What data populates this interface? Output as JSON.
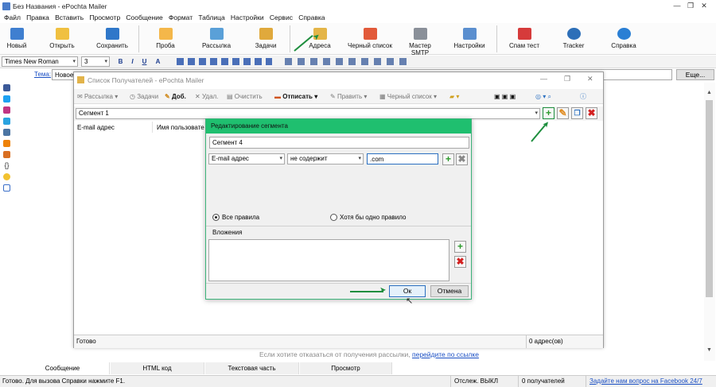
{
  "app": {
    "title": "Без Названия - ePochta Mailer"
  },
  "window_controls": {
    "minimize": "—",
    "maximize": "❐",
    "close": "✕"
  },
  "menu": [
    "Файл",
    "Правка",
    "Вставить",
    "Просмотр",
    "Сообщение",
    "Формат",
    "Таблица",
    "Настройки",
    "Сервис",
    "Справка"
  ],
  "toolbar": {
    "new": "Новый",
    "open": "Открыть",
    "save": "Сохранить",
    "test": "Проба",
    "send": "Рассылка",
    "tasks": "Задачи",
    "addresses": "Адреса",
    "blacklist": "Черный список",
    "smtp": "Мастер SMTP",
    "settings": "Настройки",
    "spamtest": "Спам тест",
    "tracker": "Tracker",
    "help": "Справка"
  },
  "format": {
    "font": "Times New Roman",
    "size": "3",
    "bold": "B",
    "italic": "I",
    "underline": "U",
    "color": "A"
  },
  "subject": {
    "label": "Тема:",
    "value": "Новое (",
    "more_button": "Еще..."
  },
  "recipients": {
    "title": "Список Получателей - ePochta Mailer",
    "toolbar": {
      "send": "Рассылка",
      "tasks": "Задачи",
      "add": "Доб.",
      "delete": "Удал.",
      "clear": "Очистить",
      "unsubscribe": "Отписать",
      "edit": "Править",
      "blacklist": "Черный список"
    },
    "segment": "Сегмент 1",
    "columns": [
      "E-mail адрес",
      "Имя пользовате"
    ],
    "status_left": "Готово",
    "status_right": "0 адрес(ов)"
  },
  "dialog": {
    "title": "Редактирование сегмента",
    "name_value": "Сегмент 4",
    "field_select": "E-mail адрес",
    "condition_select": "не содержит",
    "condition_value": ".com",
    "radio_all": "Все правила",
    "radio_any": "Хотя бы одно правило",
    "radio_all_checked": true,
    "attachments_label": "Вложения",
    "ok": "Ок",
    "cancel": "Отмена"
  },
  "footer_notice": {
    "text": "Если хотите отказаться от получения рассылки,",
    "link": "перейдите по ссылке"
  },
  "tabs": [
    "Сообщение",
    "HTML код",
    "Текстовая часть",
    "Просмотр"
  ],
  "statusbar": {
    "left": "Готово. Для вызова Справки нажмите F1.",
    "tracking": "Отслеж. ВЫКЛ",
    "recipients": "0 получателей",
    "facebook": "Задайте нам вопрос на Facebook 24/7"
  },
  "colors": {
    "accent_green": "#1fbf6f",
    "arrow_green": "#1e8e3e",
    "link_blue": "#1a4fc4"
  }
}
